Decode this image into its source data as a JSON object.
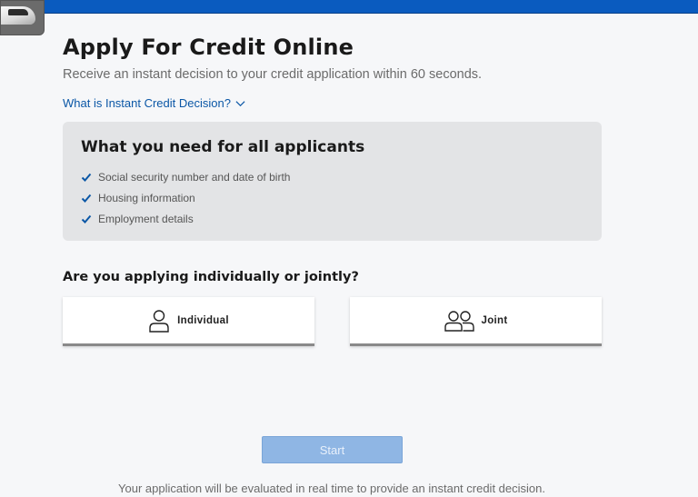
{
  "header": {
    "brand_color": "#0a5bbf",
    "thumbnail_icon": "vehicle-thumbnail"
  },
  "page": {
    "title": "Apply For Credit Online",
    "subtitle": "Receive an instant decision to your credit application within 60 seconds.",
    "disclosure_label": "What is Instant Credit Decision?",
    "disclosure_icon": "chevron-down-icon"
  },
  "requirements": {
    "title": "What you need for all applicants",
    "check_icon": "checkmark-icon",
    "items": [
      "Social security number and date of birth",
      "Housing information",
      "Employment details"
    ]
  },
  "applicant_type": {
    "question": "Are you applying individually or jointly?",
    "options": [
      {
        "label": "Individual",
        "icon": "person-icon"
      },
      {
        "label": "Joint",
        "icon": "people-icon"
      }
    ]
  },
  "actions": {
    "start_label": "Start",
    "start_state": "disabled"
  },
  "footnote": "Your application will be evaluated in real time to provide an instant credit decision."
}
